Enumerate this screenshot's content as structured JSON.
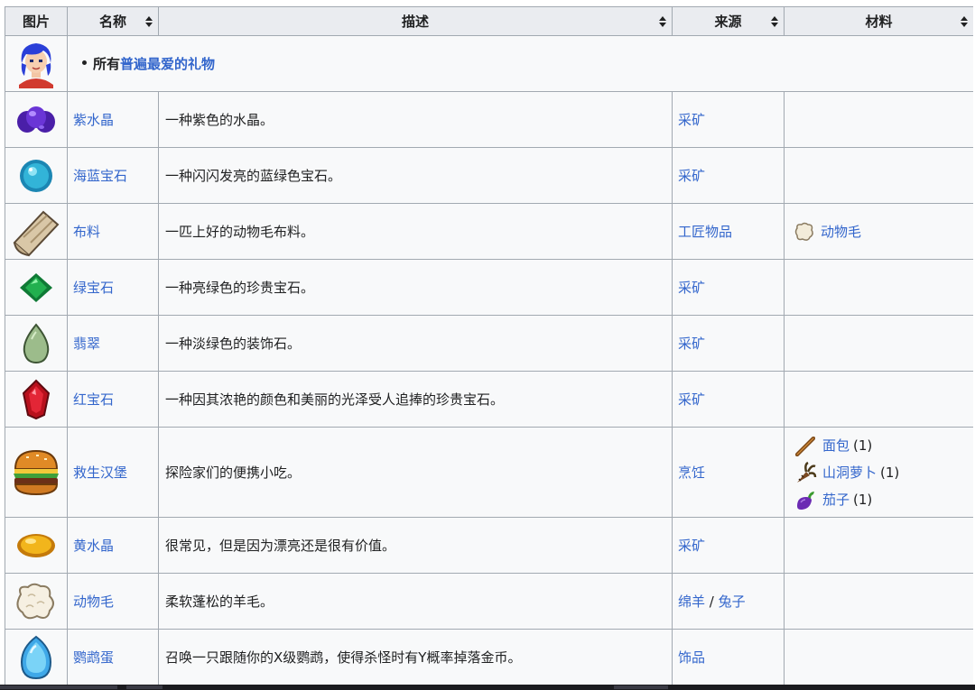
{
  "headers": {
    "image": "图片",
    "name": "名称",
    "description": "描述",
    "source": "来源",
    "materials": "材料"
  },
  "top_row": {
    "prefix": "所有",
    "link": "普遍最爱的礼物"
  },
  "rows": [
    {
      "icon": "amethyst-icon",
      "name": "紫水晶",
      "description": "一种紫色的水晶。",
      "source": "采矿"
    },
    {
      "icon": "aquamarine-icon",
      "name": "海蓝宝石",
      "description": "一种闪闪发亮的蓝绿色宝石。",
      "source": "采矿"
    },
    {
      "icon": "cloth-icon",
      "name": "布料",
      "description": "一匹上好的动物毛布料。",
      "source": "工匠物品",
      "materials": [
        {
          "icon": "wool-icon",
          "name": "动物毛"
        }
      ]
    },
    {
      "icon": "emerald-icon",
      "name": "绿宝石",
      "description": "一种亮绿色的珍贵宝石。",
      "source": "采矿"
    },
    {
      "icon": "jade-icon",
      "name": "翡翠",
      "description": "一种淡绿色的装饰石。",
      "source": "采矿"
    },
    {
      "icon": "ruby-icon",
      "name": "红宝石",
      "description": "一种因其浓艳的颜色和美丽的光泽受人追捧的珍贵宝石。",
      "source": "采矿"
    },
    {
      "icon": "survival-burger-icon",
      "name": "救生汉堡",
      "description": "探险家们的便携小吃。",
      "source": "烹饪",
      "materials": [
        {
          "icon": "bread-icon",
          "name": "面包",
          "qty": "(1)"
        },
        {
          "icon": "cave-carrot-icon",
          "name": "山洞萝卜",
          "qty": "(1)"
        },
        {
          "icon": "eggplant-icon",
          "name": "茄子",
          "qty": "(1)"
        }
      ]
    },
    {
      "icon": "topaz-icon",
      "name": "黄水晶",
      "description": "很常见，但是因为漂亮还是很有价值。",
      "source": "采矿"
    },
    {
      "icon": "wool-icon",
      "name": "动物毛",
      "description": "柔软蓬松的羊毛。",
      "source_parts": [
        "绵羊",
        " / ",
        "兔子"
      ]
    },
    {
      "icon": "parrot-egg-icon",
      "name": "鹦鹉蛋",
      "description": "召唤一只跟随你的X级鹦鹉，使得杀怪时有Y概率掉落金币。",
      "source": "饰品"
    }
  ],
  "colors": {
    "link": "#3366cc",
    "header_bg": "#eaecf0",
    "cell_bg": "#f8f9fa",
    "border": "#a2a9b1"
  }
}
